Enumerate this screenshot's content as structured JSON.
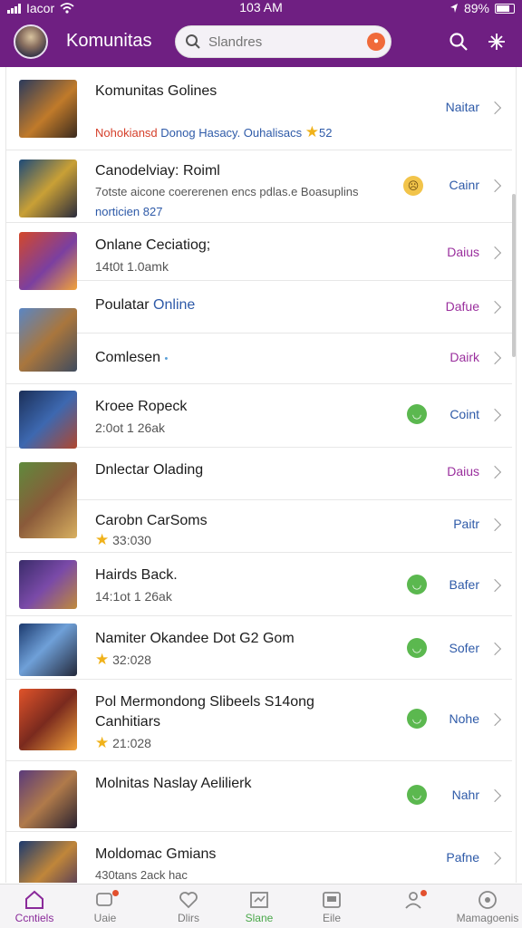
{
  "status": {
    "carrier": "Iacor",
    "time": "103 AM",
    "battery": "89%"
  },
  "header": {
    "title": "Komunitas",
    "search_placeholder": "Slandres"
  },
  "items": [
    {
      "title": "Komunitas Golines",
      "sub": "",
      "meta_a": "Nohokiansd",
      "meta_b": "Donog Hasacy. Ouhalisacs",
      "meta_rating": "52",
      "action": "Naitar",
      "badge": ""
    },
    {
      "title": "Canodelviay: Roiml",
      "sub": "7otste aicone coererenen encs pdlas.e Boasuplins",
      "meta": "norticien 827",
      "action": "Cainr",
      "badge": "emoji"
    },
    {
      "title": "Onlane Ceciatiog;",
      "sub": "14t0t 1.0amk",
      "action": "Daius",
      "badge": ""
    },
    {
      "title": "Poulatar",
      "title_accent": "Online",
      "action": "Dafue",
      "badge": ""
    },
    {
      "title": "Comlesen",
      "action": "Dairk",
      "badge": ""
    },
    {
      "title": "Kroee Ropeck",
      "sub": "2:0ot 1 26ak",
      "action": "Coint",
      "badge": "green"
    },
    {
      "title": "Dnlectar Olading",
      "action": "Daius",
      "badge": ""
    },
    {
      "title": "Carobn CarSoms",
      "rating": "33:030",
      "action": "Paitr",
      "badge": ""
    },
    {
      "title": "Hairds Back.",
      "sub": "14:1ot 1 26ak",
      "action": "Bafer",
      "badge": "green"
    },
    {
      "title": "Namiter Okandee Dot G2 Gom",
      "rating": "32:028",
      "action": "Sofer",
      "badge": "green"
    },
    {
      "title": "Pol Mermondong Slibeels S14ong",
      "title2": "Canhitiars",
      "rating": "21:028",
      "action": "Nohe",
      "badge": "green"
    },
    {
      "title": "Molnitas Naslay Aelilierk",
      "action": "Nahr",
      "badge": "green"
    },
    {
      "title": "Moldomac Gmians",
      "sub": "430tans 2ack hac",
      "action": "Pafne",
      "badge": ""
    }
  ],
  "tabs": [
    {
      "label": "Ccntiels",
      "icon": "home-icon",
      "active": true
    },
    {
      "label": "Uaie",
      "icon": "chat-icon",
      "dot": true
    },
    {
      "label": "Dlirs",
      "icon": "heart-icon"
    },
    {
      "label": "Slane",
      "icon": "chart-icon",
      "green": true
    },
    {
      "label": "Eile",
      "icon": "message-icon"
    },
    {
      "label": "",
      "icon": "profile-icon",
      "dot": true
    },
    {
      "label": "Mamagoenis",
      "icon": "settings-icon"
    }
  ],
  "colors": {
    "brand": "#6f1f82",
    "accent_blue": "#2e5aa8",
    "accent_purple": "#9a2f9d",
    "accent_red": "#d5402b",
    "badge_green": "#5bb84f",
    "star": "#f0b21b"
  }
}
